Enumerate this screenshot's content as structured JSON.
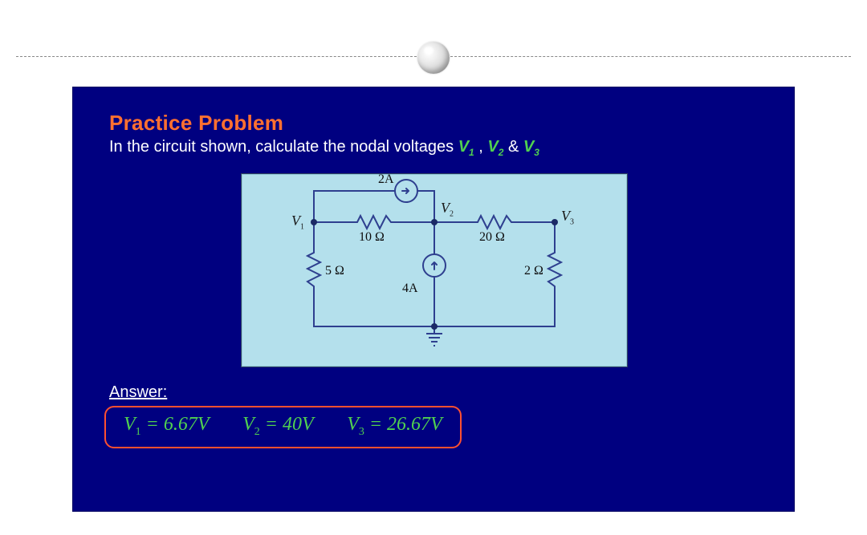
{
  "slide": {
    "title": "Practice Problem",
    "prompt_prefix": "In the circuit shown, calculate the nodal voltages ",
    "prompt_v1": "V",
    "prompt_v1_sub": "1",
    "prompt_sep1": " , ",
    "prompt_v2": "V",
    "prompt_v2_sub": "2",
    "prompt_amp": " & ",
    "prompt_v3": "V",
    "prompt_v3_sub": "3"
  },
  "circuit": {
    "nodes": {
      "v1_label": "V",
      "v1_sub": "1",
      "v2_label": "V",
      "v2_sub": "2",
      "v3_label": "V",
      "v3_sub": "3"
    },
    "components": {
      "i_top": "2A",
      "i_mid": "4A",
      "r_left_top": "10 Ω",
      "r_right_top": "20 Ω",
      "r_left_shunt": "5 Ω",
      "r_right_shunt": "2 Ω"
    }
  },
  "answer": {
    "heading": "Answer:",
    "v1": "V",
    "v1_sub": "1",
    "v1_val": " = 6.67V",
    "v2": "V",
    "v2_sub": "2",
    "v2_val": " = 40V",
    "v3": "V",
    "v3_sub": "3",
    "v3_val": " = 26.67V"
  }
}
